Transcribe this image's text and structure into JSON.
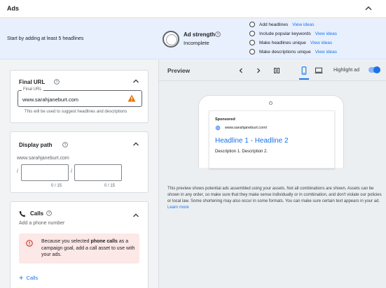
{
  "header": {
    "title": "Ads"
  },
  "banner": {
    "message": "Start by adding at least 5 headlines",
    "strength_label": "Ad strength",
    "strength_value": "Incomplete",
    "tips": [
      {
        "label": "Add headlines",
        "link": "View ideas"
      },
      {
        "label": "Include popular keywords",
        "link": "View ideas"
      },
      {
        "label": "Make headlines unique",
        "link": "View ideas"
      },
      {
        "label": "Make descriptions unique",
        "link": "View ideas"
      }
    ]
  },
  "final_url": {
    "title": "Final URL",
    "field_label": "Final URL",
    "value": "www.sarahjaneburt.com",
    "hint": "This will be used to suggest headlines and descriptions"
  },
  "display_path": {
    "title": "Display path",
    "base": "www.sarahjaneburt.com",
    "slash": "/",
    "count1": "0 / 15",
    "count2": "0 / 15"
  },
  "calls": {
    "title": "Calls",
    "subtitle": "Add a phone number",
    "alert_pre": "Because you selected ",
    "alert_bold": "phone calls",
    "alert_post": " as a campaign goal, add a call asset to use with your ads.",
    "add_label": "Calls"
  },
  "preview": {
    "title": "Preview",
    "highlight_label": "Highlight ad",
    "highlight_on": true,
    "ad": {
      "sponsored": "Sponsored",
      "url": "www.sarahjaneburt.com/",
      "headline": "Headline 1 - Headline 2",
      "description": "Description 1. Description 2."
    },
    "disclaimer": "This preview shows potential ads assembled using your assets. Not all combinations are shown. Assets can be shown in any order, so make sure that they make sense individually or in combination, and don't violate our policies or local law. Some shortening may also occur in some formats. You can make sure certain text appears in your ad.",
    "learn_more": "Learn more"
  },
  "colors": {
    "accent": "#1a73e8",
    "banner_bg": "#e8f0fe",
    "alert_bg": "#fce8e6",
    "warning": "#e37400"
  }
}
